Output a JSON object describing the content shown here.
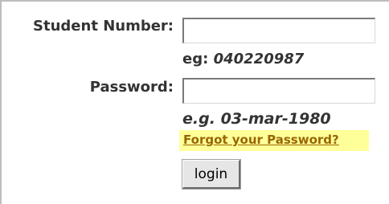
{
  "form": {
    "student_number": {
      "label": "Student Number:",
      "value": "",
      "hint_prefix": "eg:",
      "hint_example": "040220987"
    },
    "password": {
      "label": "Password:",
      "value": "",
      "hint_prefix": "e.g.",
      "hint_example": "03-mar-1980"
    },
    "forgot_link_label": "Forgot your Password?",
    "login_button_label": "login"
  },
  "colors": {
    "label_text": "#333333",
    "link_text": "#996600",
    "link_highlight": "#ffff99",
    "button_face": "#e6e6e6"
  }
}
